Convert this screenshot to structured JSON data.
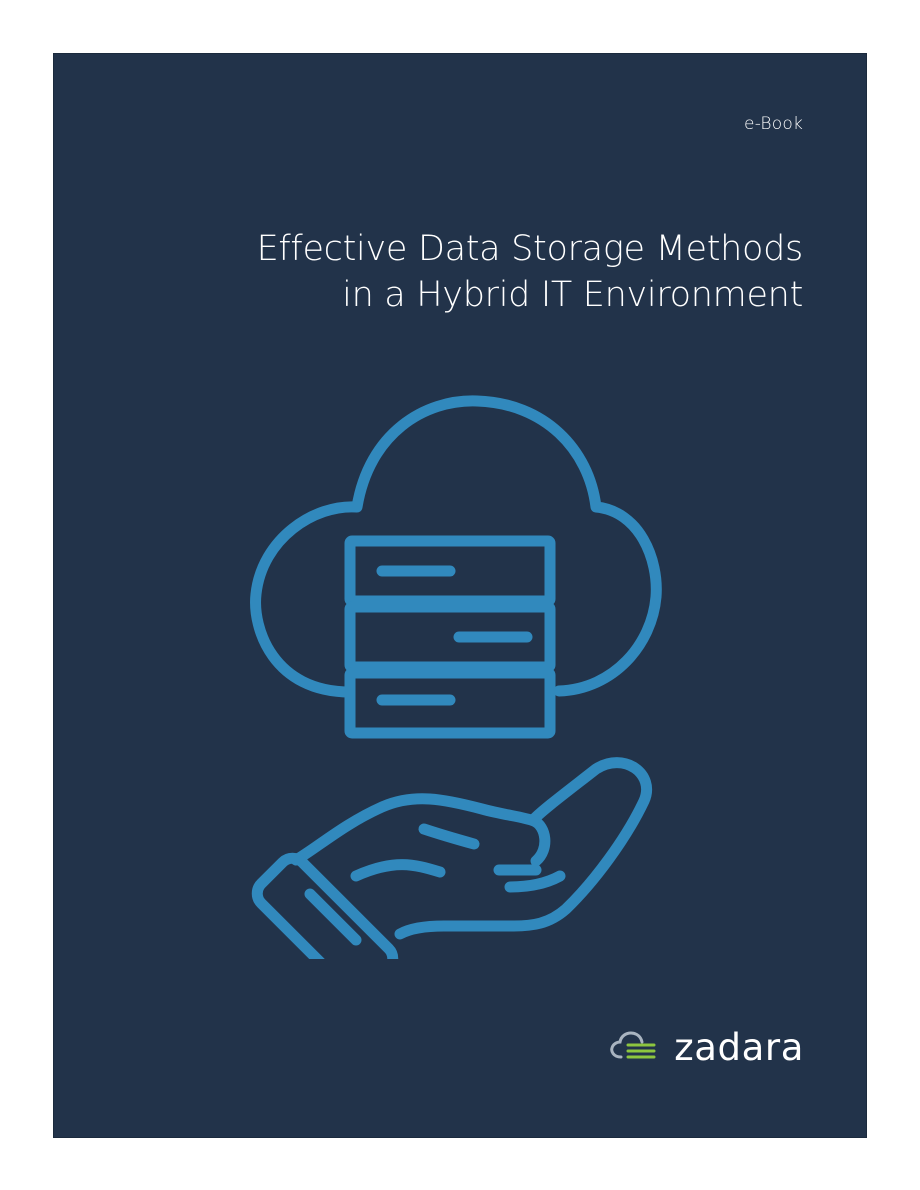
{
  "cover": {
    "doc_type": "e-Book",
    "title_lines": [
      "Effective Data Storage Methods",
      "in a Hybrid IT Environment"
    ],
    "brand_name": "zadara"
  },
  "illustration": {
    "icon": "cloud-server-hand-icon"
  },
  "colors": {
    "background": "#22334a",
    "accent_blue": "#3189bd",
    "brand_green": "#8dc63f",
    "brand_gray": "#a9b4c0",
    "text": "#ffffff"
  }
}
